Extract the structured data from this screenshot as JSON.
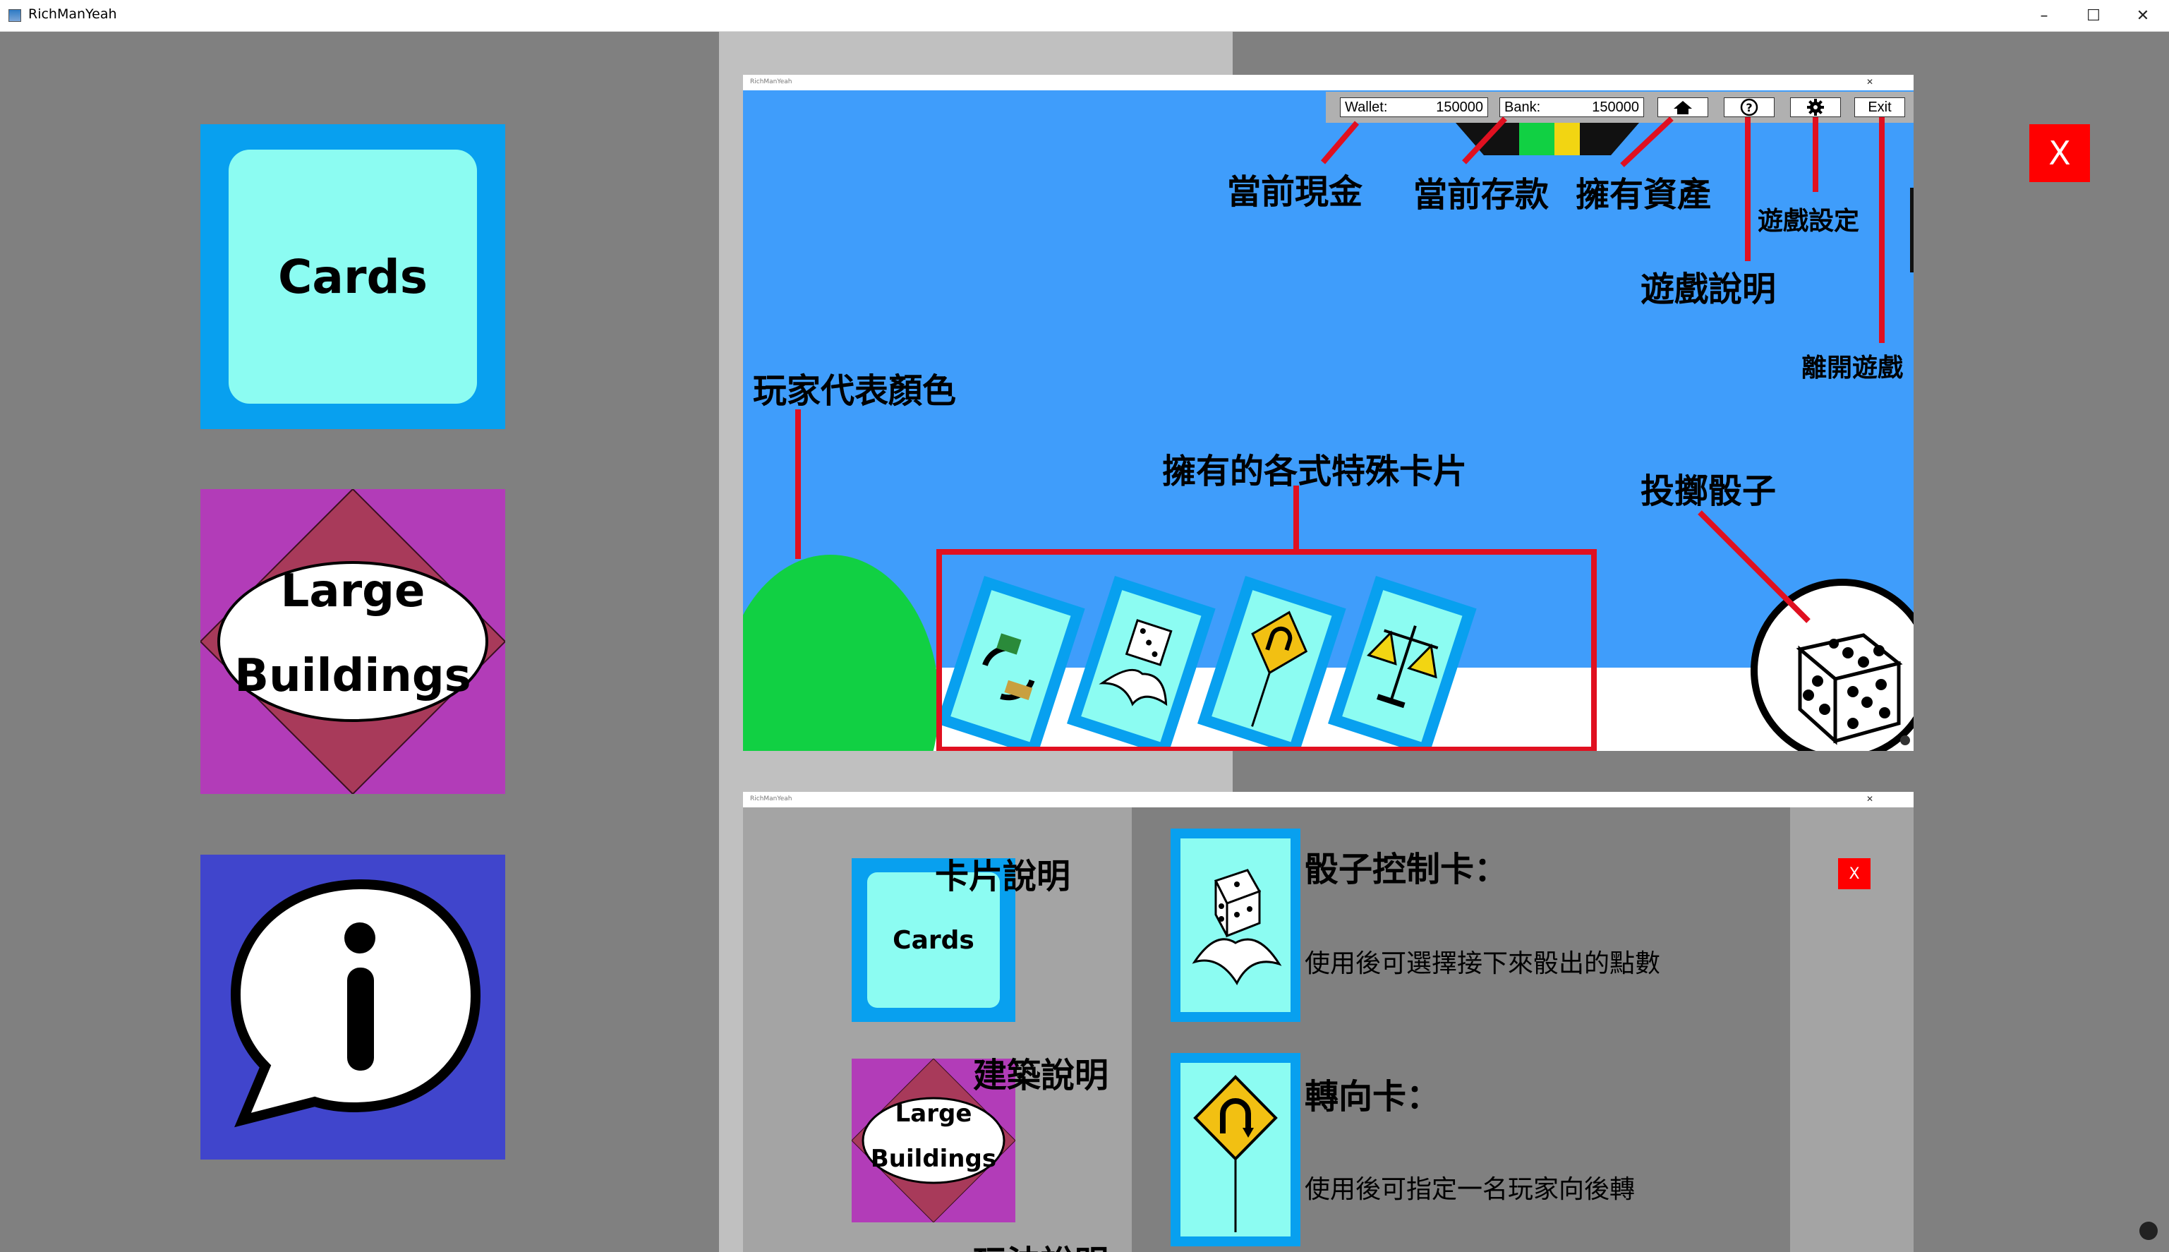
{
  "window": {
    "title": "RichManYeah",
    "controls": [
      "–",
      "☐",
      "✕"
    ]
  },
  "menu": {
    "cards_label": "Cards",
    "buildings_label_1": "Large",
    "buildings_label_2": "Buildings",
    "info_icon": "info-speech-bubble-icon"
  },
  "close_button": {
    "label": "X"
  },
  "shot1": {
    "title": "RichManYeah",
    "hud": {
      "wallet_label": "Wallet:",
      "wallet_value": "150000",
      "bank_label": "Bank:",
      "bank_value": "150000",
      "exit_label": "Exit"
    },
    "annotations": {
      "cash": "當前現金",
      "deposit": "當前存款",
      "assets": "擁有資產",
      "settings": "遊戲設定",
      "help": "遊戲說明",
      "leave": "離開遊戲",
      "player_color": "玩家代表顏色",
      "cards": "擁有的各式特殊卡片",
      "dice": "投擲骰子"
    }
  },
  "shot2": {
    "title": "RichManYeah",
    "close_label": "X",
    "menu": {
      "cards_heading": "卡片說明",
      "cards_label": "Cards",
      "buildings_heading": "建築說明",
      "buildings_label_1": "Large",
      "buildings_label_2": "Buildings",
      "rules_heading": "玩法說明"
    },
    "cards": [
      {
        "name": "骰子控制卡：",
        "desc": "使用後可選擇接下來骰出的點數",
        "icon": "dice-hand-icon"
      },
      {
        "name": "轉向卡：",
        "desc": "使用後可指定一名玩家向後轉",
        "icon": "u-turn-sign-icon"
      }
    ]
  },
  "colors": {
    "background": "#808080",
    "accent_blue": "#08a0ef",
    "card_cyan": "#8cfcf2",
    "purple": "#b23cb8",
    "maroon": "#a83a5a",
    "info_blue": "#4045cc",
    "red": "#ff0000",
    "game_sky": "#3f9dfb",
    "player_green": "#11d043"
  }
}
